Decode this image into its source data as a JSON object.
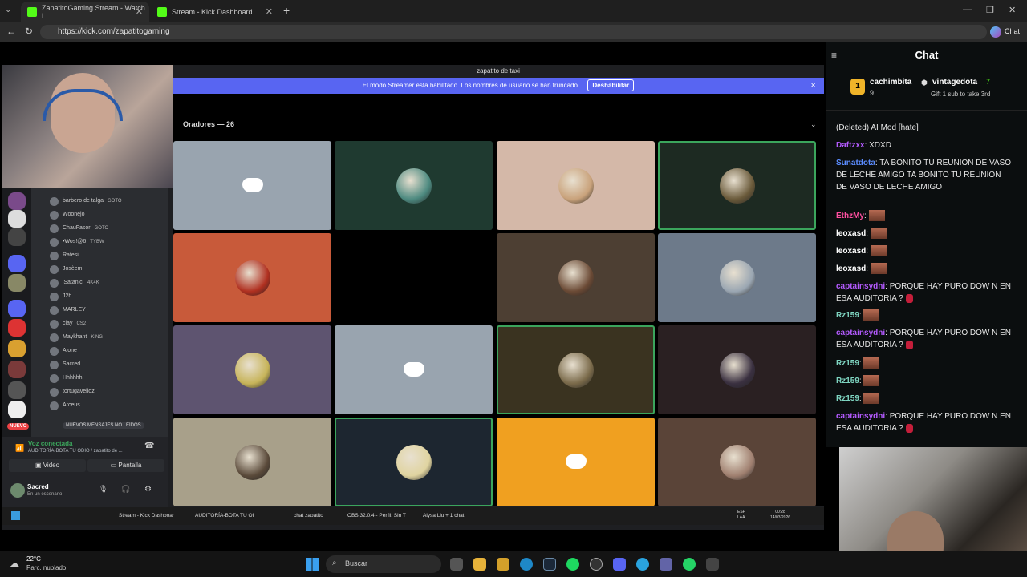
{
  "browser": {
    "tabs": [
      {
        "title": "ZapatitoGaming Stream - Watch L",
        "icon_color": "#53fc18"
      },
      {
        "title": "Stream - Kick Dashboard",
        "icon_color": "#53fc18"
      }
    ],
    "url": "https://kick.com/zapatitogaming",
    "chat_button": "Chat"
  },
  "discord": {
    "window_title": "zapatito de taxi",
    "streamer_banner": "El modo Streamer está habilitado. Los nombres de usuario se han truncado.",
    "streamer_button": "Deshabilitar",
    "speakers_label": "Oradores — 26",
    "tiles": [
      {
        "bg": "#99a4af",
        "type": "discord"
      },
      {
        "bg": "#1f3a30",
        "avatar": "#4d8a80"
      },
      {
        "bg": "#d4b8a8",
        "avatar": "#c9a27b"
      },
      {
        "bg": "#1d2a22",
        "avatar": "#6a5a3a",
        "selected": true
      },
      {
        "bg": "#c85a3a",
        "avatar": "#b03020"
      },
      {
        "bg": "#000000"
      },
      {
        "bg": "#4d3f33",
        "avatar": "#6b4a35"
      },
      {
        "bg": "#6d7a8a",
        "avatar": "#9aa6b2"
      },
      {
        "bg": "#5e5470",
        "avatar": "#c7b45a"
      },
      {
        "bg": "#99a4af",
        "type": "discord"
      },
      {
        "bg": "#3a3320",
        "avatar": "#7a6a4a",
        "selected": true
      },
      {
        "bg": "#2a2022",
        "avatar": "#3a3040"
      },
      {
        "bg": "#a8a08a",
        "avatar": "#5a4a3a"
      },
      {
        "bg": "#1d2630",
        "avatar": "#e0d4a0",
        "selected": true
      },
      {
        "bg": "#f0a020",
        "type": "discord"
      },
      {
        "bg": "#5a4438",
        "avatar": "#a08070"
      }
    ],
    "members": [
      {
        "name": "barbero de talga",
        "tag": "GOTO"
      },
      {
        "name": "Woonejo",
        "tag": ""
      },
      {
        "name": "ChauFasor",
        "tag": "GOTO"
      },
      {
        "name": "•Wos!@6",
        "tag": "TYBW"
      },
      {
        "name": "Ratesi",
        "tag": ""
      },
      {
        "name": "Josèem",
        "tag": ""
      },
      {
        "name": "'Satanic'",
        "tag": "4K4K"
      },
      {
        "name": "J2h",
        "tag": ""
      },
      {
        "name": "MARLEY",
        "tag": ""
      },
      {
        "name": "clay",
        "tag": "CS2"
      },
      {
        "name": "Maykhant",
        "tag": "KING"
      },
      {
        "name": "Alone",
        "tag": ""
      },
      {
        "name": "Sacred",
        "tag": ""
      },
      {
        "name": "Hhhhhh",
        "tag": ""
      },
      {
        "name": "tortugavelioz",
        "tag": ""
      },
      {
        "name": "Arceus",
        "tag": ""
      }
    ],
    "new_messages": "NUEVOS MENSAJES NO LEÍDOS",
    "server_new": "NUEVO",
    "voice_connected": "Voz conectada",
    "voice_channel": "AUDITORÍA-BOTA TU ODIO / zapatito de ...",
    "video_button": "Video",
    "screen_button": "Pantalla",
    "user_name": "Sacred",
    "user_status": "En un escenario"
  },
  "chat": {
    "title": "Chat",
    "pinned": [
      {
        "rank": "1",
        "name": "cachimbita",
        "count": "9"
      },
      {
        "name": "vintagedota",
        "count": "7"
      }
    ],
    "gift_text": "Gift 1 sub to take 3rd",
    "messages": [
      {
        "user": "",
        "text": "(Deleted) AI Mod [hate]"
      },
      {
        "user": "Daftzxx",
        "text": "XDXD",
        "color": "#b45bff"
      },
      {
        "user": "Sunatdota",
        "text": "TA BONITO TU REUNION DE VASO DE LECHE AMIGO TA BONITO TU REUNION DE VASO DE LECHE AMIGO",
        "color": "#5b8cff"
      },
      {
        "user": "EthzMy",
        "text": "",
        "color": "#ff4fa0"
      },
      {
        "user": "leoxasd",
        "text": "",
        "color": "#ffffff"
      },
      {
        "user": "leoxasd",
        "text": "",
        "color": "#ffffff"
      },
      {
        "user": "leoxasd",
        "text": "",
        "color": "#ffffff"
      },
      {
        "user": "captainsydni",
        "text": "PORQUE HAY PURO DOW N EN ESA AUDITORIA ?",
        "color": "#b45bff"
      },
      {
        "user": "Rz159",
        "text": "",
        "color": "#7fd6c2"
      },
      {
        "user": "captainsydni",
        "text": "PORQUE HAY PURO DOW N EN ESA AUDITORIA ?",
        "color": "#b45bff"
      },
      {
        "user": "Rz159",
        "text": "",
        "color": "#7fd6c2"
      },
      {
        "user": "Rz159",
        "text": "",
        "color": "#7fd6c2"
      },
      {
        "user": "Rz159",
        "text": "",
        "color": "#7fd6c2"
      },
      {
        "user": "captainsydni",
        "text": "PORQUE HAY PURO DOW N EN ESA AUDITORIA ?",
        "color": "#b45bff"
      }
    ]
  },
  "inner_taskbar": {
    "items": [
      "Stream - Kick Dashboar",
      "AUDITORÍA-BOTA TU OI",
      "chat zapatito",
      "OBS 32.0.4 - Perfil: Sin T",
      "Alysa Liu + 1 chat"
    ],
    "lang": "ESP",
    "lang2": "LAA",
    "time": "00:28",
    "date": "14/03/2026"
  },
  "taskbar": {
    "weather_temp": "22°C",
    "weather_desc": "Parc. nublado",
    "search_placeholder": "Buscar"
  }
}
